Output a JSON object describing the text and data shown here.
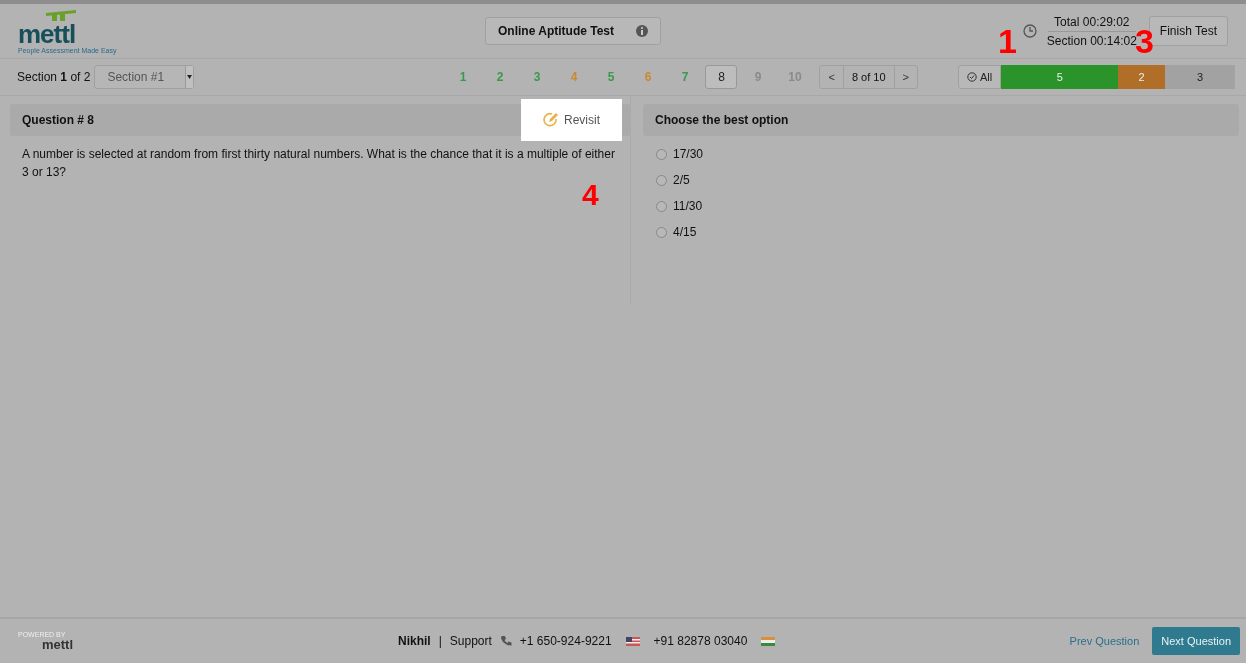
{
  "header": {
    "logo": "mettl",
    "tagline": "People Assessment Made Easy",
    "test_title": "Online Aptitude Test",
    "timer": {
      "total": "Total 00:29:02",
      "section": "Section 00:14:02"
    },
    "finish_button": "Finish Test"
  },
  "section_bar": {
    "section_label": "Section **1** of 2",
    "section_select": "Section #1",
    "questions": [
      {
        "label": "1",
        "color": "#3a9a4a",
        "selected": false
      },
      {
        "label": "2",
        "color": "#3a9a4a",
        "selected": false
      },
      {
        "label": "3",
        "color": "#3a9a4a",
        "selected": false
      },
      {
        "label": "4",
        "color": "#c98a2e",
        "selected": false
      },
      {
        "label": "5",
        "color": "#3a9a4a",
        "selected": false
      },
      {
        "label": "6",
        "color": "#c98a2e",
        "selected": false
      },
      {
        "label": "7",
        "color": "#3a9a4a",
        "selected": false
      },
      {
        "label": "8",
        "color": "#222222",
        "selected": true
      },
      {
        "label": "9",
        "color": "#8a8a8a",
        "selected": false
      },
      {
        "label": "10",
        "color": "#8a8a8a",
        "selected": false
      }
    ],
    "prev": "<",
    "pager": "8 of 10",
    "next": ">",
    "filter_all": "All",
    "summary": [
      {
        "count": "5",
        "color": "#2a942a"
      },
      {
        "count": "2",
        "color": "#b06e28"
      },
      {
        "count": "3",
        "color": "#a2a2a2"
      }
    ]
  },
  "question": {
    "title": "Question # 8",
    "revisit": "Revisit",
    "text": "A number is selected at random from first thirty natural numbers. What is the chance that it is a multiple of either 3 or 13?"
  },
  "answers": {
    "title": "Choose the best option",
    "options": [
      {
        "label": "17/30",
        "selected": false
      },
      {
        "label": "2/5",
        "selected": false
      },
      {
        "label": "11/30",
        "selected": false
      },
      {
        "label": "4/15",
        "selected": false
      }
    ]
  },
  "annotations": [
    "1",
    "3",
    "4"
  ],
  "footer": {
    "powered_by": "POWERED BY",
    "logo": "mettl",
    "user": "Nikhil",
    "separator": "|",
    "support": "Support",
    "phone_us": "+1 650-924-9221",
    "phone_in": "+91 82878 03040",
    "prev_button": "Prev Question",
    "next_button": "Next Question"
  }
}
